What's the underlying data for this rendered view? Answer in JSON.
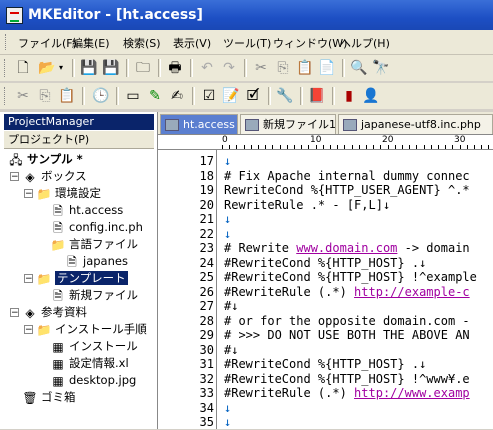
{
  "title": "MKEditor - [ht.access]",
  "menu": [
    "ファイル(F)",
    "編集(E)",
    "検索(S)",
    "表示(V)",
    "ツール(T)",
    "ウィンドウ(W)",
    "ヘルプ(H)"
  ],
  "project_manager": {
    "title": "ProjectManager",
    "sub": "プロジェクト(P)",
    "tree": [
      {
        "label": "サンプル *",
        "level": 0,
        "icon": "project-icon",
        "bold": true
      },
      {
        "label": "ボックス",
        "level": 1,
        "icon": "box-icon"
      },
      {
        "label": "環境設定",
        "level": 2,
        "icon": "folder-icon"
      },
      {
        "label": "ht.access",
        "level": 3,
        "icon": "file-icon"
      },
      {
        "label": "config.inc.ph",
        "level": 3,
        "icon": "file-icon"
      },
      {
        "label": "言語ファイル",
        "level": 3,
        "icon": "folder-icon"
      },
      {
        "label": "japanes",
        "level": 4,
        "icon": "file-icon"
      },
      {
        "label": "テンプレート",
        "level": 2,
        "icon": "folder-icon",
        "selected": true
      },
      {
        "label": "新規ファイル",
        "level": 3,
        "icon": "file-icon"
      },
      {
        "label": "参考資料",
        "level": 1,
        "icon": "box-icon"
      },
      {
        "label": "インストール手順",
        "level": 2,
        "icon": "folder-icon"
      },
      {
        "label": "インストール",
        "level": 3,
        "icon": "image-icon"
      },
      {
        "label": "設定情報.xl",
        "level": 3,
        "icon": "image-icon"
      },
      {
        "label": "desktop.jpg",
        "level": 3,
        "icon": "image-icon"
      },
      {
        "label": "ゴミ箱",
        "level": 1,
        "icon": "trash-icon"
      }
    ]
  },
  "tabs": [
    "ht.access",
    "新規ファイル1",
    "japanese-utf8.inc.php"
  ],
  "ruler": [
    "0",
    "10",
    "20",
    "30"
  ],
  "lines": [
    {
      "n": "17",
      "t": "↓"
    },
    {
      "n": "18",
      "t": "# Fix Apache internal dummy connec"
    },
    {
      "n": "19",
      "t": "RewriteCond %{HTTP_USER_AGENT} ^.*"
    },
    {
      "n": "20",
      "t": "RewriteRule .* - [F,L]↓"
    },
    {
      "n": "21",
      "t": "↓"
    },
    {
      "n": "22",
      "t": "↓"
    },
    {
      "n": "23",
      "t": "# Rewrite ",
      "u": "www.domain.com",
      "a": " -> domain"
    },
    {
      "n": "24",
      "t": "#RewriteCond %{HTTP_HOST} .↓"
    },
    {
      "n": "25",
      "t": "#RewriteCond %{HTTP_HOST} !^example"
    },
    {
      "n": "26",
      "t": "#RewriteRule (.*) ",
      "u": "http://example-c",
      "a": ""
    },
    {
      "n": "27",
      "t": "#↓"
    },
    {
      "n": "28",
      "t": "# or for the opposite domain.com -"
    },
    {
      "n": "29",
      "t": "# >>> DO NOT USE BOTH THE ABOVE AN"
    },
    {
      "n": "30",
      "t": "#↓"
    },
    {
      "n": "31",
      "t": "#RewriteCond %{HTTP_HOST} .↓"
    },
    {
      "n": "32",
      "t": "#RewriteCond %{HTTP_HOST} !^www¥.e"
    },
    {
      "n": "33",
      "t": "#RewriteRule (.*) ",
      "u": "http://www.examp",
      "a": ""
    },
    {
      "n": "34",
      "t": "↓"
    },
    {
      "n": "35",
      "t": "↓"
    }
  ]
}
